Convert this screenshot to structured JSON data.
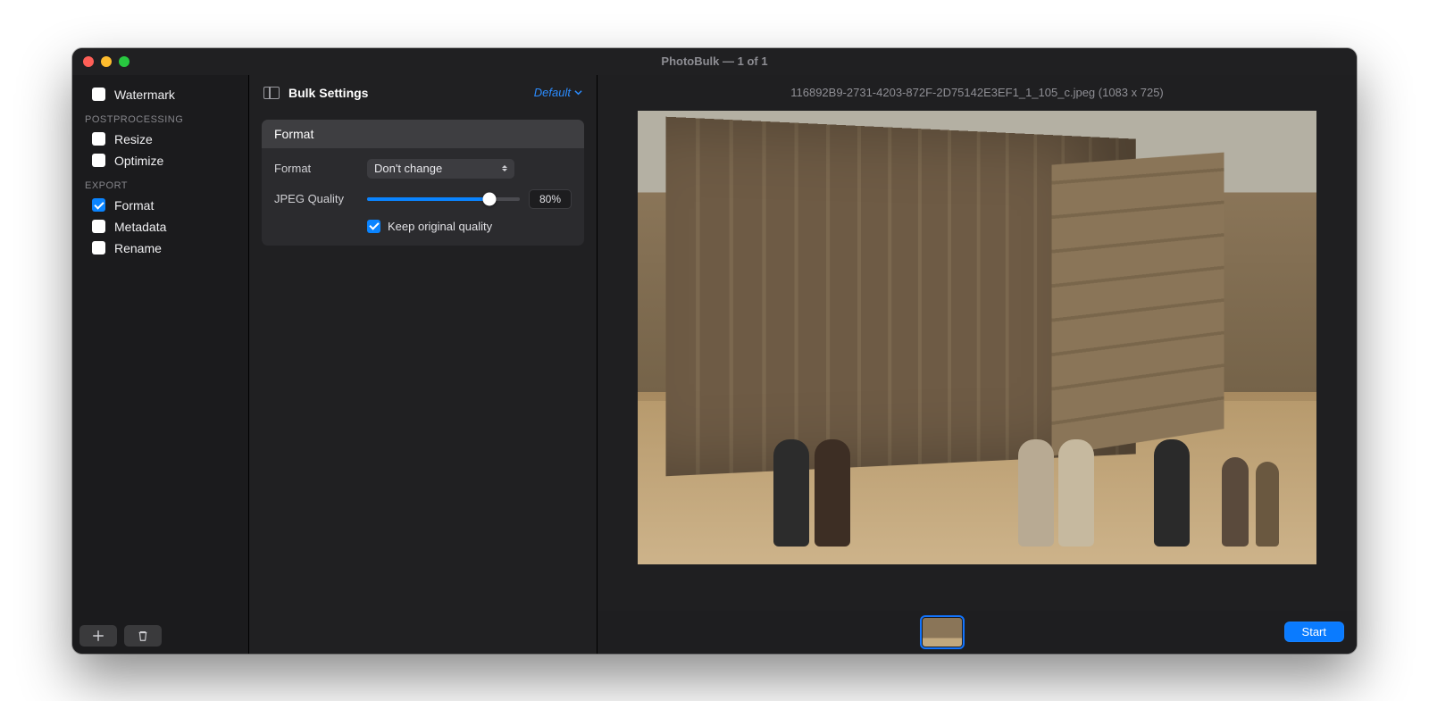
{
  "window": {
    "title": "PhotoBulk — 1 of 1"
  },
  "sidebar": {
    "items": [
      {
        "label": "Watermark",
        "checked": false
      }
    ],
    "groups": [
      {
        "label": "POSTPROCESSING",
        "items": [
          {
            "label": "Resize",
            "checked": false
          },
          {
            "label": "Optimize",
            "checked": false
          }
        ]
      },
      {
        "label": "EXPORT",
        "items": [
          {
            "label": "Format",
            "checked": true
          },
          {
            "label": "Metadata",
            "checked": false
          },
          {
            "label": "Rename",
            "checked": false
          }
        ]
      }
    ]
  },
  "settings": {
    "header": {
      "title": "Bulk Settings",
      "preset": "Default"
    },
    "card": {
      "title": "Format",
      "format_label": "Format",
      "format_value": "Don't change",
      "quality_label": "JPEG Quality",
      "quality_value": "80%",
      "quality_percent": 80,
      "keep_original_label": "Keep original quality",
      "keep_original_checked": true
    }
  },
  "preview": {
    "filename": "116892B9-2731-4203-872F-2D75142E3EF1_1_105_c.jpeg (1083 x 725)"
  },
  "footer": {
    "start_label": "Start"
  }
}
